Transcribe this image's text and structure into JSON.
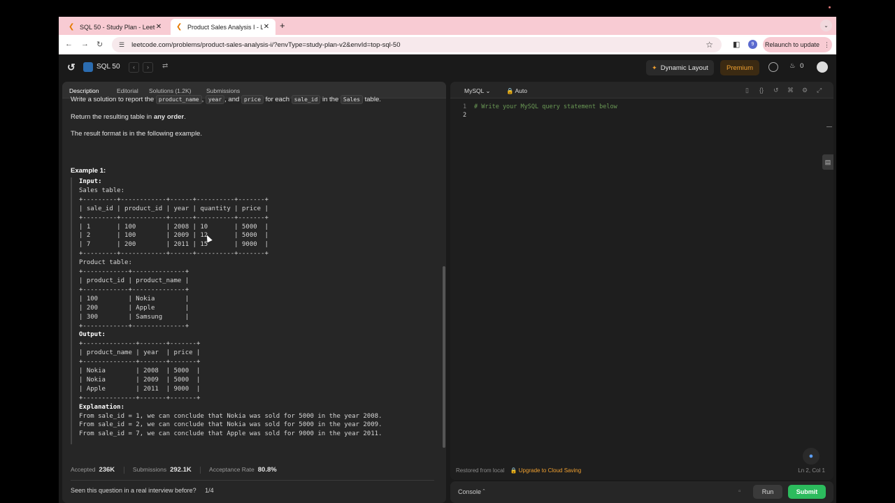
{
  "browser": {
    "tabs": [
      {
        "title": "SQL 50 - Study Plan - LeetCode"
      },
      {
        "title": "Product Sales Analysis I - LeetCode"
      }
    ],
    "url": "leetcode.com/problems/product-sales-analysis-i/?envType=study-plan-v2&envId=top-sql-50",
    "relaunch_label": "Relaunch to update",
    "profile_initial": "9"
  },
  "nav": {
    "list_title": "SQL 50",
    "dynamic_layout": "Dynamic Layout",
    "premium": "Premium",
    "streak": "0"
  },
  "left_tabs": [
    {
      "label": "Description"
    },
    {
      "label": "Editorial"
    },
    {
      "label": "Solutions (1.2K)"
    },
    {
      "label": "Submissions"
    }
  ],
  "description": {
    "line1_a": "Write a solution to report the",
    "code_product_name": "product_name",
    "comma1": ",",
    "code_year": "year",
    "and": ", and",
    "code_price": "price",
    "for_each": "for each",
    "code_sale_id": "sale_id",
    "in_the": "in the",
    "code_sales": "Sales",
    "table": "table.",
    "line2_a": "Return the resulting table in",
    "line2_b": "any order",
    "line2_c": ".",
    "line3": "The result format is in the following example.",
    "example_title": "Example 1:",
    "example_block": "Input: \nSales table:\n+---------+------------+------+----------+-------+\n| sale_id | product_id | year | quantity | price |\n+---------+------------+------+----------+-------+ \n| 1       | 100        | 2008 | 10       | 5000  |\n| 2       | 100        | 2009 | 12       | 5000  |\n| 7       | 200        | 2011 | 15       | 9000  |\n+---------+------------+------+----------+-------+\nProduct table:\n+------------+--------------+\n| product_id | product_name |\n+------------+--------------+\n| 100        | Nokia        |\n| 200        | Apple        |\n| 300        | Samsung      |\n+------------+--------------+\nOutput: \n+--------------+-------+-------+\n| product_name | year  | price |\n+--------------+-------+-------+\n| Nokia        | 2008  | 5000  |\n| Nokia        | 2009  | 5000  |\n| Apple        | 2011  | 9000  |\n+--------------+-------+-------+\nExplanation: \nFrom sale_id = 1, we can conclude that Nokia was sold for 5000 in the year 2008.\nFrom sale_id = 2, we can conclude that Nokia was sold for 5000 in the year 2009.\nFrom sale_id = 7, we can conclude that Apple was sold for 9000 in the year 2011."
  },
  "stats": {
    "accepted_label": "Accepted",
    "accepted_value": "236K",
    "submissions_label": "Submissions",
    "submissions_value": "292.1K",
    "rate_label": "Acceptance Rate",
    "rate_value": "80.8%"
  },
  "seen": {
    "question": "Seen this question in a real interview before?",
    "page": "1/4"
  },
  "editor": {
    "language": "MySQL",
    "mode": "Auto",
    "line_numbers": [
      "1",
      "2"
    ],
    "code_line1": "# Write your MySQL query statement below",
    "restored": "Restored from local",
    "upgrade": "Upgrade to Cloud Saving",
    "position": "Ln 2, Col 1"
  },
  "bottom": {
    "console": "Console",
    "run": "Run",
    "submit": "Submit"
  }
}
